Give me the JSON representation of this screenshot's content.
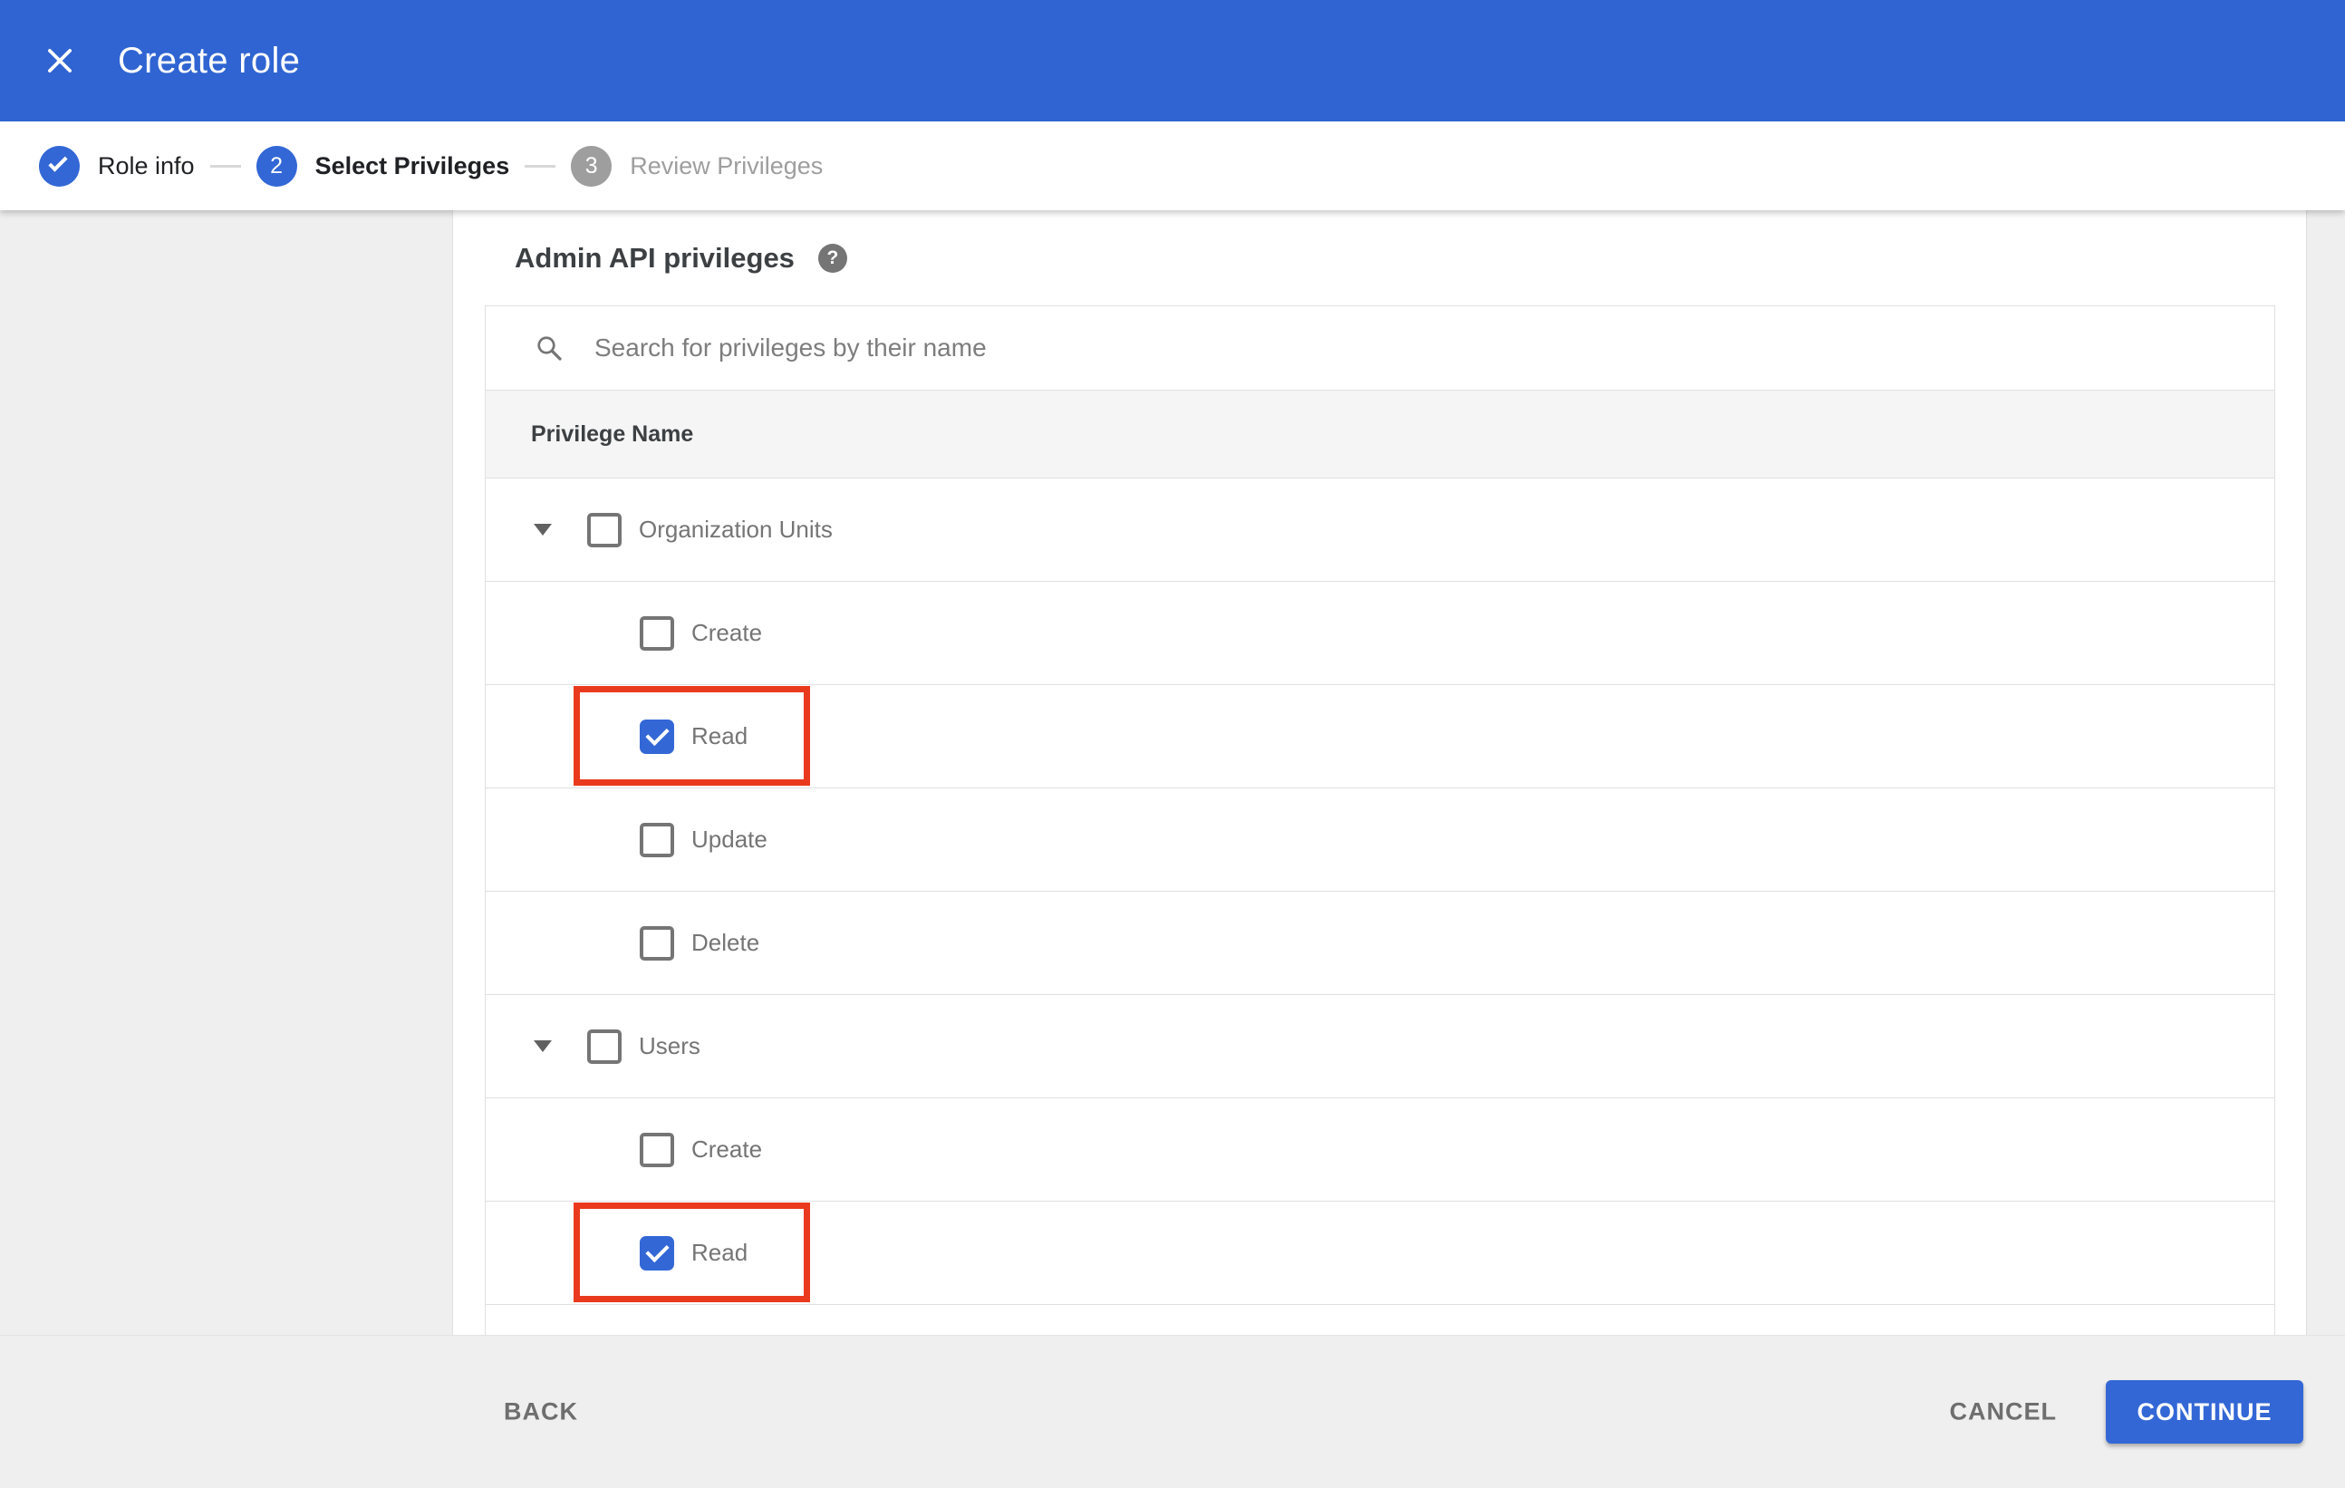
{
  "appbar": {
    "title": "Create role",
    "close_icon": "x",
    "bg_color": "#2f64d2"
  },
  "stepper": {
    "steps": [
      {
        "label": "Role info",
        "state": "complete",
        "icon": "check"
      },
      {
        "label": "Select Privileges",
        "state": "active",
        "number": "2"
      },
      {
        "label": "Review Privileges",
        "state": "upcoming",
        "number": "3"
      }
    ]
  },
  "panel": {
    "heading": "Admin API privileges",
    "help_icon": "?",
    "search_placeholder": "Search for privileges by their name",
    "search_value": "",
    "table": {
      "header": "Privilege Name",
      "rows": [
        {
          "type": "group",
          "label": "Organization Units",
          "checked": false,
          "highlighted": false
        },
        {
          "type": "child",
          "label": "Create",
          "checked": false,
          "highlighted": false
        },
        {
          "type": "child",
          "label": "Read",
          "checked": true,
          "highlighted": true
        },
        {
          "type": "child",
          "label": "Update",
          "checked": false,
          "highlighted": false
        },
        {
          "type": "child",
          "label": "Delete",
          "checked": false,
          "highlighted": false
        },
        {
          "type": "group",
          "label": "Users",
          "checked": false,
          "highlighted": false
        },
        {
          "type": "child",
          "label": "Create",
          "checked": false,
          "highlighted": false
        },
        {
          "type": "child",
          "label": "Read",
          "checked": true,
          "highlighted": true
        },
        {
          "type": "spacer",
          "label": "",
          "checked": false,
          "highlighted": false
        }
      ]
    }
  },
  "footer": {
    "back_label": "BACK",
    "cancel_label": "CANCEL",
    "continue_label": "CONTINUE"
  },
  "colors": {
    "appbar_blue": "#2f64d2",
    "control_blue": "#3367d6",
    "highlight_red": "#ea3a1d",
    "step_inactive_gray": "#9e9e9e",
    "row_border": "#e0e0e0",
    "header_row_bg": "#f5f5f5",
    "footer_bg": "#efefef"
  }
}
